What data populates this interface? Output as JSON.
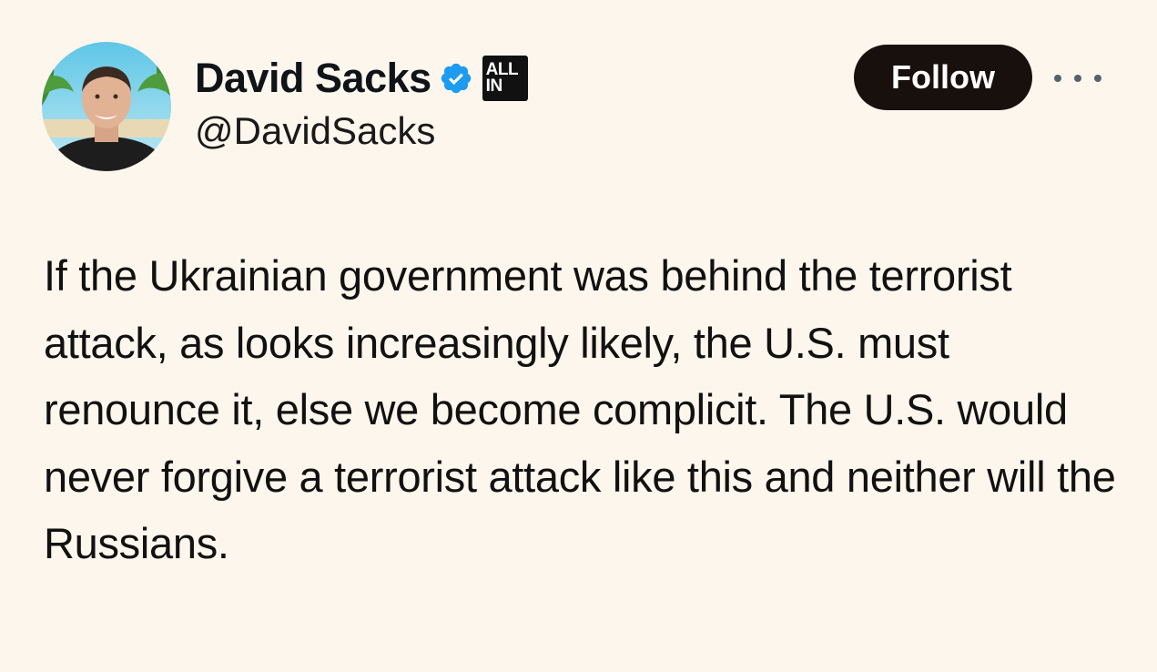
{
  "tweet": {
    "author": {
      "display_name": "David Sacks",
      "handle": "@DavidSacks",
      "verified_icon": "verified-badge-icon",
      "affiliate_badge": {
        "line1": "ALL",
        "line2": "IN"
      }
    },
    "follow_label": "Follow",
    "more_icon": "more-options-icon",
    "text": "If the Ukrainian government was behind the terrorist attack, as looks increasingly likely, the U.S. must renounce it, else we become complicit. The U.S. would never forgive a terrorist attack like this and neither will the Russians."
  },
  "colors": {
    "background": "#fdf6ed",
    "follow_button": "#17100d",
    "verified_blue": "#1d9bf0",
    "text": "#111111"
  }
}
